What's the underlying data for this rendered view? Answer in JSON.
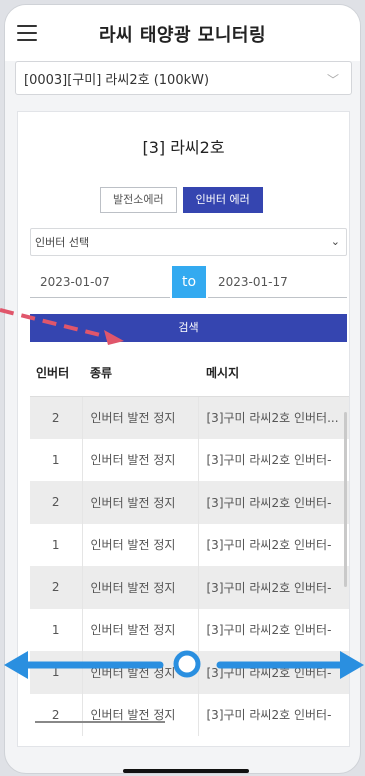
{
  "header": {
    "title": "라씨 태양광 모니터링",
    "menu_icon": "hamburger-menu-icon"
  },
  "site_selector": {
    "value": "[0003][구미] 라씨2호 (100kW)",
    "icon": "chevron-down-icon"
  },
  "card": {
    "title": "[3] 라씨2호",
    "tabs": [
      {
        "label": "발전소에러",
        "active": false
      },
      {
        "label": "인버터 에러",
        "active": true
      }
    ],
    "inverter_select": {
      "value": "인버터 선택",
      "icon": "chevron-down-icon"
    },
    "date_from": "2023-01-07",
    "date_to_label": "to",
    "date_to": "2023-01-17",
    "search_label": "검색"
  },
  "table": {
    "columns": [
      "인버터",
      "종류",
      "메시지"
    ],
    "rows": [
      [
        "2",
        "인버터 발전 정지",
        "[3]구미 라씨2호 인버터..."
      ],
      [
        "1",
        "인버터 발전 정지",
        "[3]구미 라씨2호 인버터-"
      ],
      [
        "2",
        "인버터 발전 정지",
        "[3]구미 라씨2호 인버터-"
      ],
      [
        "1",
        "인버터 발전 정지",
        "[3]구미 라씨2호 인버터-"
      ],
      [
        "2",
        "인버터 발전 정지",
        "[3]구미 라씨2호 인버터-"
      ],
      [
        "1",
        "인버터 발전 정지",
        "[3]구미 라씨2호 인버터-"
      ],
      [
        "1",
        "인버터 발전 정지",
        "[3]구미 라씨2호 인버터-"
      ],
      [
        "2",
        "인버터 발전 정지",
        "[3]구미 라씨2호 인버터-"
      ]
    ]
  },
  "colors": {
    "accent": "#3545b0",
    "to_badge": "#33aaf0",
    "gesture_arrow": "#2a8fe0",
    "pointer_arrow": "#e0566b"
  },
  "overlay_icons": [
    "swipe-horizontal-gesture-icon",
    "dashed-pointer-arrow-icon"
  ]
}
